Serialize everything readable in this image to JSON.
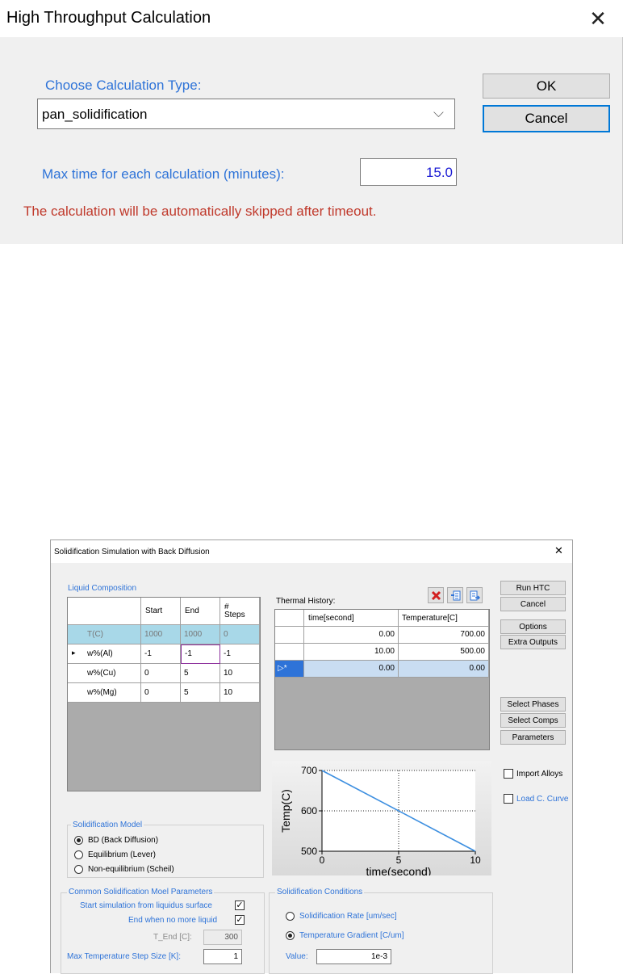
{
  "dialog1": {
    "title": "High Throughput Calculation",
    "close_glyph": "✕",
    "choose_label": "Choose Calculation Type:",
    "calc_type_value": "pan_solidification",
    "combo_arrow": "⌵",
    "ok_label": "OK",
    "cancel_label": "Cancel",
    "max_time_label": "Max time for each calculation (minutes):",
    "max_time_value": "15.0",
    "timeout_note": "The calculation will be automatically skipped after timeout.",
    "colors": {
      "label_blue": "#2e73d8",
      "error_red": "#c0392b",
      "value_blue": "#1a1ad4"
    }
  },
  "dialog2": {
    "title": "Solidification Simulation with Back Diffusion",
    "close_glyph": "✕",
    "liquid_composition": {
      "title": "Liquid Composition",
      "headers": {
        "start": "Start",
        "end": "End",
        "steps_line1": "#",
        "steps_line2": "Steps"
      },
      "row_marker": "▸",
      "rows": [
        {
          "name": "T(C)",
          "start": "1000",
          "end": "1000",
          "steps": "0"
        },
        {
          "name": "w%(Al)",
          "start": "-1",
          "end": "-1",
          "steps": "-1"
        },
        {
          "name": "w%(Cu)",
          "start": "0",
          "end": "5",
          "steps": "10"
        },
        {
          "name": "w%(Mg)",
          "start": "0",
          "end": "5",
          "steps": "10"
        }
      ]
    },
    "thermal_history": {
      "title": "Thermal History:",
      "headers": {
        "time": "time[second]",
        "temp": "Temperature[C]"
      },
      "new_row_marker": "▷*",
      "rows": [
        {
          "time": "0.00",
          "temp": "700.00"
        },
        {
          "time": "10.00",
          "temp": "500.00"
        },
        {
          "time": "0.00",
          "temp": "0.00"
        }
      ],
      "icons": [
        "delete-icon",
        "insert-row-icon",
        "export-icon"
      ]
    },
    "buttons": {
      "run_htc": "Run HTC",
      "cancel": "Cancel",
      "options": "Options",
      "extra_outputs": "Extra Outputs",
      "select_phases": "Select Phases",
      "select_comps": "Select Comps",
      "parameters": "Parameters"
    },
    "import_alloys_label": "Import Alloys",
    "load_curve_label": "Load C. Curve",
    "solidification_model": {
      "title": "Solidification Model",
      "options": [
        {
          "label": "BD (Back Diffusion)",
          "selected": true
        },
        {
          "label": "Equilibrium (Lever)",
          "selected": false
        },
        {
          "label": "Non-equilibrium (Scheil)",
          "selected": false
        }
      ]
    },
    "common_params": {
      "title": "Common Solidification Moel Parameters",
      "start_liquidus_label": "Start simulation from liquidus surface",
      "start_liquidus_checked": true,
      "end_no_liquid_label": "End when no more liquid",
      "end_no_liquid_checked": true,
      "t_end_label": "T_End [C]:",
      "t_end_value": "300",
      "max_step_label": "Max Temperature Step Size [K]:",
      "max_step_value": "1",
      "check_glyph": "✓"
    },
    "conditions": {
      "title": "Solidification Conditions",
      "rate_label": "Solidification Rate [um/sec]",
      "rate_selected": false,
      "gradient_label": "Temperature Gradient [C/um]",
      "gradient_selected": true,
      "value_label": "Value:",
      "value": "1e-3"
    }
  },
  "chart_data": {
    "type": "line",
    "xlabel": "time(second)",
    "ylabel": "Temp(C)",
    "xlim": [
      0,
      10
    ],
    "ylim": [
      500,
      700
    ],
    "xticks": [
      "0",
      "5",
      "10"
    ],
    "yticks": [
      "500",
      "600",
      "700"
    ],
    "grid": "dotted at x=5 and y=600",
    "series": [
      {
        "x": [
          0,
          10
        ],
        "y": [
          700,
          500
        ],
        "color": "#3d8fe0"
      }
    ]
  }
}
